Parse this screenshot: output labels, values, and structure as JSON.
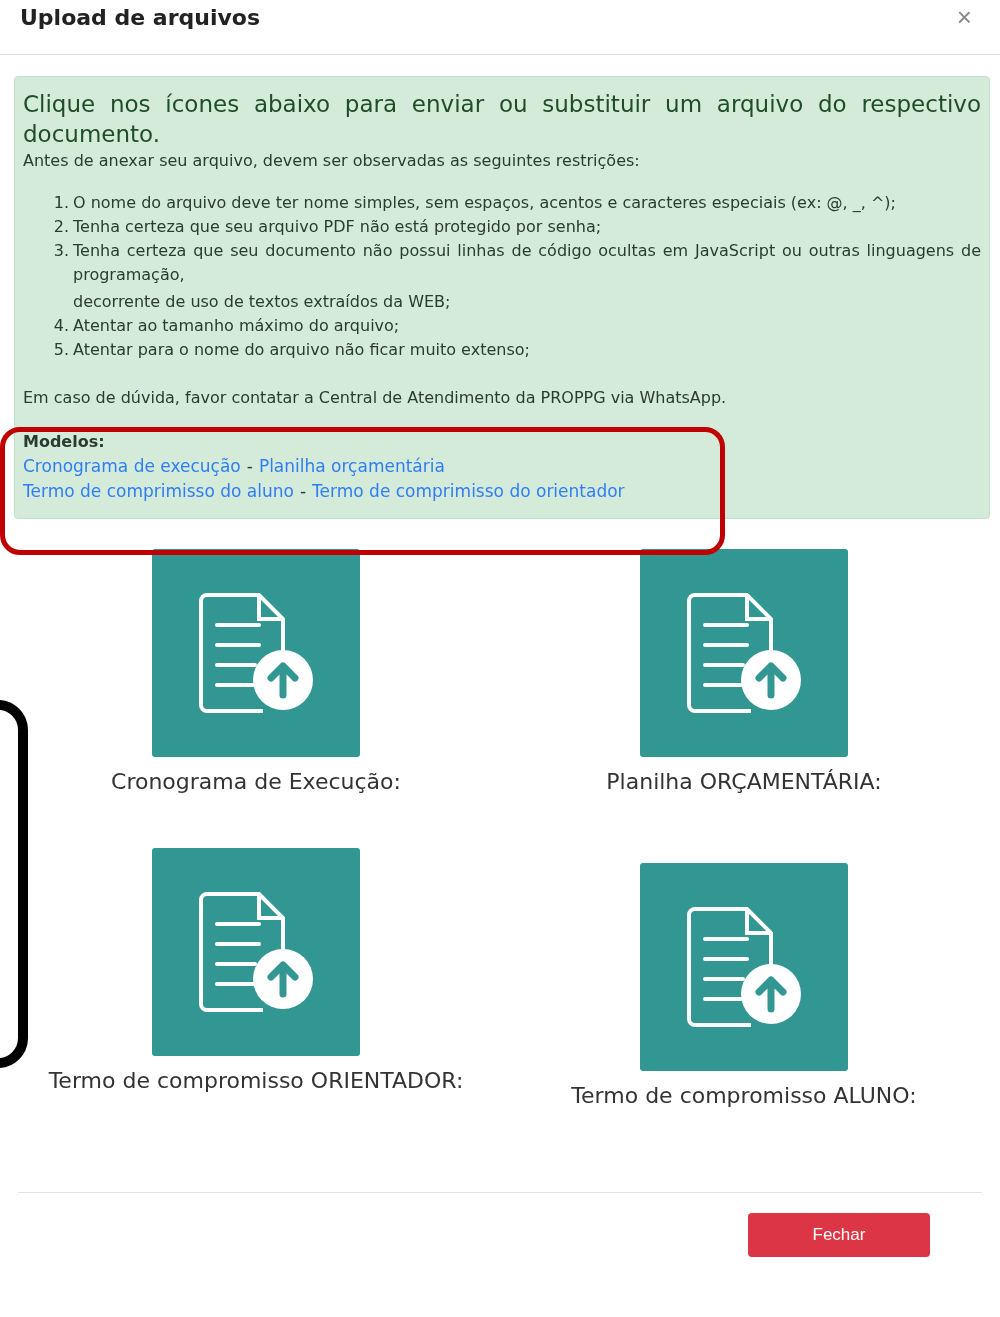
{
  "modal": {
    "title": "Upload de arquivos",
    "close": "×"
  },
  "alert": {
    "heading": "Clique nos ícones abaixo para enviar ou substituir um arquivo do respectivo documento.",
    "intro": "Antes de anexar seu arquivo, devem ser observadas as seguintes restrições:",
    "rules": [
      {
        "number": "1.",
        "text": "O nome do arquivo deve ter nome simples, sem espaços, acentos e caracteres especiais (ex: @, _, ^);"
      },
      {
        "number": "2.",
        "text": "Tenha certeza que seu arquivo PDF não está protegido por senha;"
      },
      {
        "number": "3.",
        "text": "Tenha certeza que seu documento não possui linhas de código ocultas em JavaScript ou outras linguagens de programação,",
        "continuation": "decorrente de uso de textos extraídos da WEB;"
      },
      {
        "number": "4.",
        "text": "Atentar ao tamanho máximo do arquivo;"
      },
      {
        "number": "5.",
        "text": "Atentar para o nome do arquivo não ficar muito extenso;"
      }
    ],
    "contact": "Em caso de dúvida, favor contatar a Central de Atendimento da PROPPG via WhatsApp.",
    "models_label": "Modelos:",
    "model_rows": [
      {
        "links": [
          "Cronograma de execução",
          "Planilha orçamentária"
        ],
        "separator": "-"
      },
      {
        "links": [
          "Termo de comprimisso do aluno",
          "Termo de comprimisso do orientador"
        ],
        "separator": "-"
      }
    ]
  },
  "uploads": [
    {
      "label": "Cronograma de Execução:"
    },
    {
      "label": "Planilha ORÇAMENTÁRIA:"
    },
    {
      "label": "Termo de compromisso ORIENTADOR:"
    },
    {
      "label": "Termo de compromisso ALUNO:"
    }
  ],
  "footer": {
    "button": "Fechar"
  }
}
